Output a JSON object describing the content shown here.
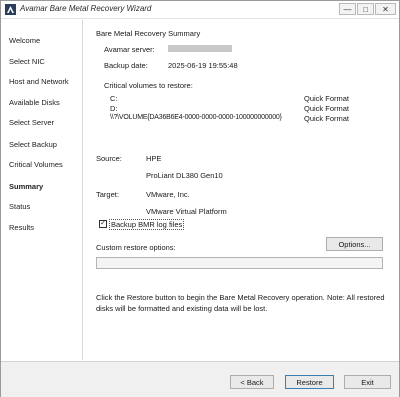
{
  "window": {
    "title": "Avamar Bare Metal Recovery Wizard",
    "minimize": "—",
    "maximize": "□",
    "close": "✕"
  },
  "sidebar": {
    "items": [
      {
        "label": "Welcome"
      },
      {
        "label": "Select NIC"
      },
      {
        "label": "Host and Network"
      },
      {
        "label": "Available Disks"
      },
      {
        "label": "Select Server"
      },
      {
        "label": "Select Backup"
      },
      {
        "label": "Critical Volumes"
      },
      {
        "label": "Summary"
      },
      {
        "label": "Status"
      },
      {
        "label": "Results"
      }
    ],
    "active": "Summary"
  },
  "summary": {
    "heading": "Bare Metal Recovery Summary",
    "server_label": "Avamar server:",
    "backup_date_label": "Backup date:",
    "backup_date": "2025-06-19 19:55:48",
    "critical_volumes_label": "Critical volumes to restore:",
    "volumes": [
      {
        "name": "C:",
        "action": "Quick Format"
      },
      {
        "name": "D:",
        "action": "Quick Format"
      },
      {
        "name": "\\\\?\\VOLUME{DA36B6E4-0000-0000-0000-100000000000}",
        "action": "Quick Format"
      }
    ],
    "source_label": "Source:",
    "source_vendor": "HPE",
    "source_model": "ProLiant DL380 Gen10",
    "target_label": "Target:",
    "target_vendor": "VMware, Inc.",
    "target_model": "VMware Virtual Platform",
    "backup_logs_label": "Backup BMR log files",
    "backup_logs_checked": true,
    "custom_options_label": "Custom restore options:",
    "custom_options_value": "",
    "options_button": "Options...",
    "note": "Click the Restore button to begin the Bare Metal Recovery operation. Note: All restored disks will be formatted and existing data will be lost."
  },
  "footer": {
    "back": "< Back",
    "restore": "Restore",
    "exit": "Exit"
  }
}
